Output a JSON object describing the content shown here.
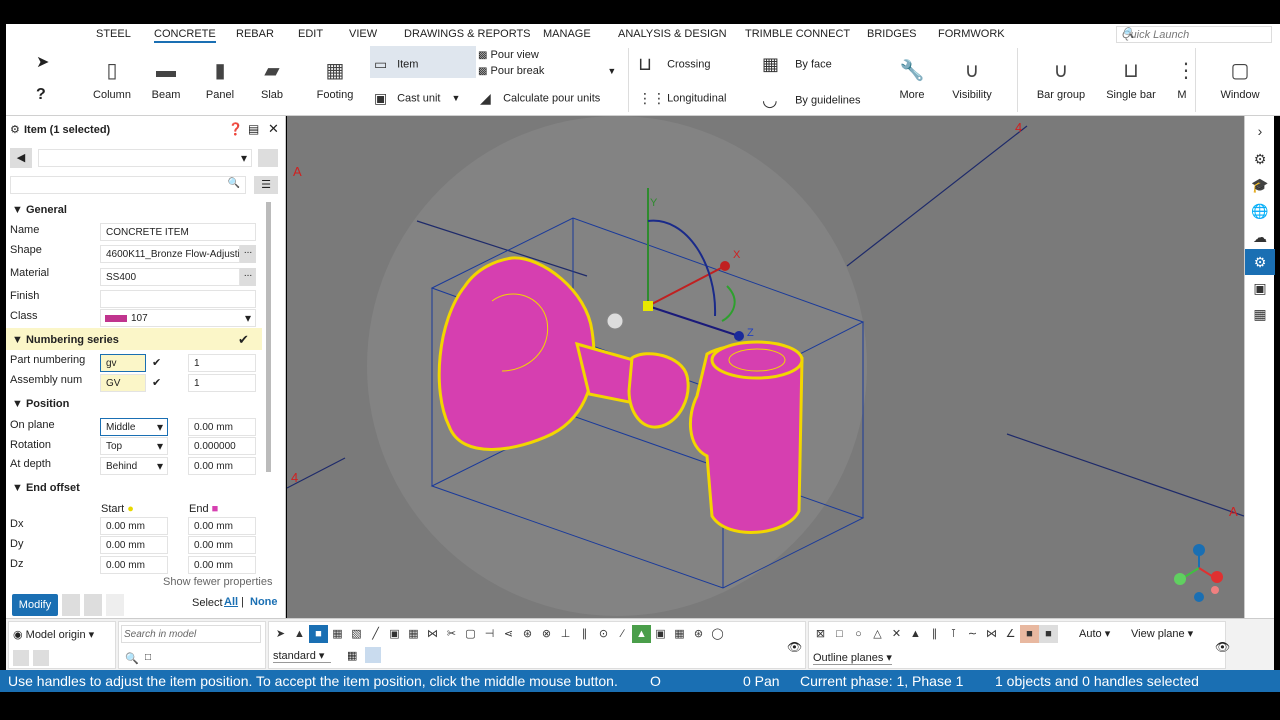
{
  "menu": {
    "tabs": [
      "STEEL",
      "CONCRETE",
      "REBAR",
      "EDIT",
      "VIEW",
      "DRAWINGS & REPORTS",
      "MANAGE",
      "ANALYSIS & DESIGN",
      "TRIMBLE CONNECT",
      "BRIDGES",
      "FORMWORK"
    ],
    "active_tab": "CONCRETE",
    "quick_launch_placeholder": "Quick Launch"
  },
  "ribbon": {
    "column": "Column",
    "beam": "Beam",
    "panel": "Panel",
    "slab": "Slab",
    "footing": "Footing",
    "item": "Item",
    "cast_unit": "Cast unit",
    "pour_view": "Pour view",
    "pour_break": "Pour break",
    "calculate_pour_units": "Calculate pour units",
    "crossing": "Crossing",
    "longitudinal": "Longitudinal",
    "by_face": "By face",
    "by_guidelines": "By guidelines",
    "more": "More",
    "visibility": "Visibility",
    "bar_group": "Bar group",
    "single_bar": "Single bar",
    "window": "Window",
    "m_cut": "M"
  },
  "panel": {
    "title": "Item (1 selected)",
    "general_header": "General",
    "name_label": "Name",
    "name_value": "CONCRETE ITEM",
    "shape_label": "Shape",
    "shape_value": "4600K11_Bronze Flow-Adjusti",
    "material_label": "Material",
    "material_value": "SS400",
    "finish_label": "Finish",
    "finish_value": "",
    "class_label": "Class",
    "class_value": "107",
    "class_color": "#c0348e",
    "numbering_header": "Numbering series",
    "part_numbering_label": "Part numbering",
    "part_prefix": "gv",
    "part_start": "1",
    "assembly_label": "Assembly num",
    "assembly_prefix": "GV",
    "assembly_start": "1",
    "position_header": "Position",
    "on_plane_label": "On plane",
    "on_plane_value": "Middle",
    "on_plane_offset": "0.00 mm",
    "rotation_label": "Rotation",
    "rotation_value": "Top",
    "rotation_offset": "0.000000",
    "at_depth_label": "At depth",
    "at_depth_value": "Behind",
    "at_depth_offset": "0.00 mm",
    "end_offset_header": "End offset",
    "start_label": "Start",
    "end_label": "End",
    "dx_label": "Dx",
    "dy_label": "Dy",
    "dz_label": "Dz",
    "dx_start": "0.00 mm",
    "dx_end": "0.00 mm",
    "dy_start": "0.00 mm",
    "dy_end": "0.00 mm",
    "dz_start": "0.00 mm",
    "dz_end": "0.00 mm",
    "show_fewer": "Show fewer properties",
    "modify": "Modify",
    "select_label": "Select",
    "select_all": "All",
    "select_sep": "|",
    "select_none": "None"
  },
  "viewport": {
    "grid_label_a": "A",
    "grid_label_4": "4",
    "axis_y": "Y",
    "axis_x": "X",
    "axis_z": "Z"
  },
  "bottom": {
    "model_origin": "Model origin",
    "search_placeholder": "Search in model",
    "standard": "standard",
    "auto": "Auto",
    "view_plane": "View plane",
    "outline_planes": "Outline planes"
  },
  "status": {
    "message": "Use handles to adjust the item position. To accept the item position, click the middle mouse button.",
    "mode": "O",
    "pan": "0 Pan",
    "phase": "Current phase: 1, Phase 1",
    "selection": "1 objects and 0 handles selected"
  },
  "colors": {
    "accent": "#1a6fb3",
    "object_fill": "#d63fb0",
    "object_outline": "#f2d600"
  }
}
